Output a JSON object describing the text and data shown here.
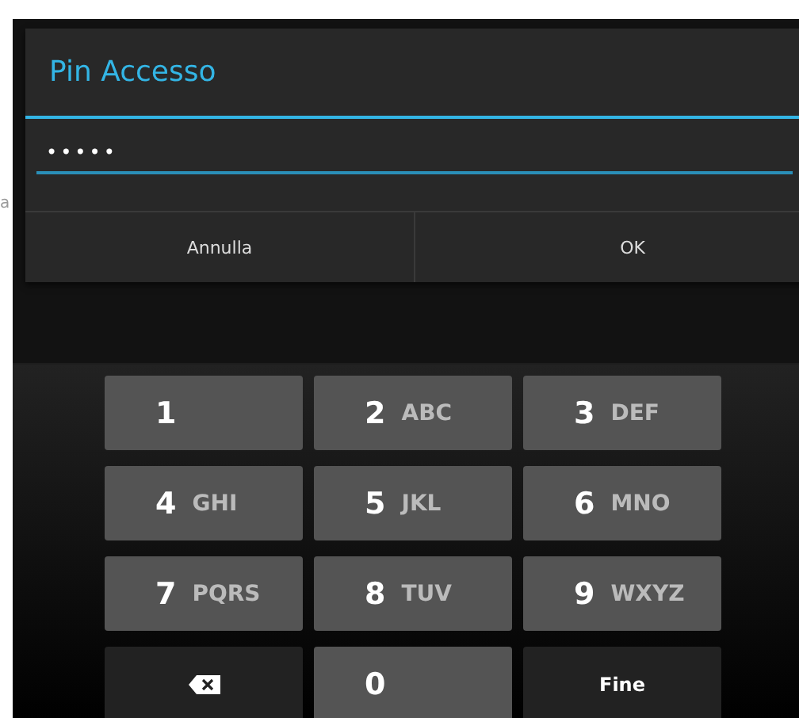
{
  "background_fragment": "a",
  "dialog": {
    "title": "Pin Accesso",
    "pin_value": "•••••",
    "buttons": [
      "Annulla",
      "OK"
    ]
  },
  "keypad": [
    {
      "kind": "digit",
      "digit": "1"
    },
    {
      "kind": "digit",
      "digit": "2",
      "letters": "ABC"
    },
    {
      "kind": "digit",
      "digit": "3",
      "letters": "DEF"
    },
    {
      "kind": "digit",
      "digit": "4",
      "letters": "GHI"
    },
    {
      "kind": "digit",
      "digit": "5",
      "letters": "JKL"
    },
    {
      "kind": "digit",
      "digit": "6",
      "letters": "MNO"
    },
    {
      "kind": "digit",
      "digit": "7",
      "letters": "PQRS"
    },
    {
      "kind": "digit",
      "digit": "8",
      "letters": "TUV"
    },
    {
      "kind": "digit",
      "digit": "9",
      "letters": "WXYZ"
    },
    {
      "kind": "backspace"
    },
    {
      "kind": "digit",
      "digit": "0"
    },
    {
      "kind": "done",
      "label": "Fine"
    }
  ]
}
